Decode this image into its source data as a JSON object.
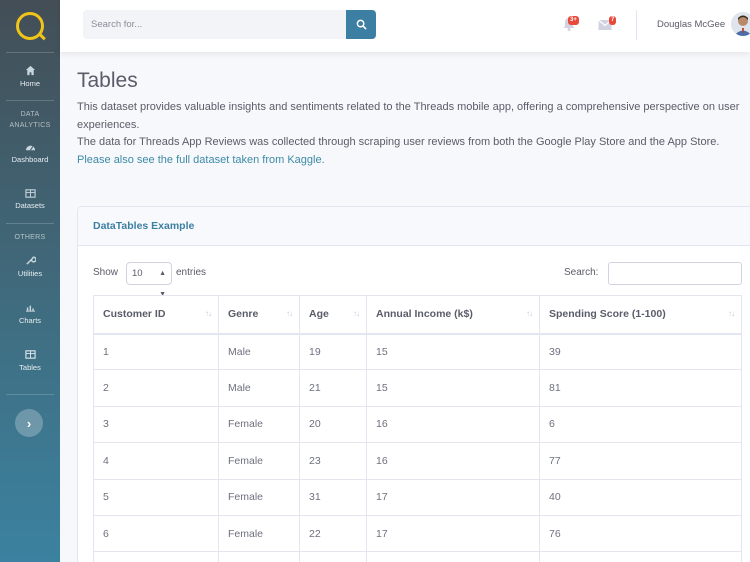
{
  "sidebar": {
    "items": [
      {
        "label": "Home",
        "icon": "home-icon"
      },
      {
        "label": "Dashboard",
        "icon": "dashboard-icon"
      },
      {
        "label": "Datasets",
        "icon": "table-icon"
      },
      {
        "label": "Utilities",
        "icon": "wrench-icon"
      },
      {
        "label": "Charts",
        "icon": "chart-icon"
      },
      {
        "label": "Tables",
        "icon": "table-icon"
      }
    ],
    "heading_data": "DATA ANALYTICS",
    "heading_others": "OTHERS",
    "toggle_label": "›"
  },
  "topbar": {
    "search_placeholder": "Search for...",
    "alerts_badge": "3+",
    "messages_badge": "7",
    "user_name": "Douglas McGee"
  },
  "page": {
    "title": "Tables",
    "desc1": "This dataset provides valuable insights and sentiments related to the Threads mobile app, offering a comprehensive perspective on user experiences.",
    "desc2": "The data for Threads App Reviews was collected through scraping user reviews from both the Google Play Store and the App Store.",
    "link": "Please also see the full dataset taken from Kaggle."
  },
  "card": {
    "title": "DataTables Example",
    "show_label": "Show",
    "entries_value": "10",
    "entries_label": "entries",
    "search_label": "Search:"
  },
  "table": {
    "columns": [
      "Customer ID",
      "Genre",
      "Age",
      "Annual Income (k$)",
      "Spending Score (1-100)"
    ],
    "rows": [
      [
        "1",
        "Male",
        "19",
        "15",
        "39"
      ],
      [
        "2",
        "Male",
        "21",
        "15",
        "81"
      ],
      [
        "3",
        "Female",
        "20",
        "16",
        "6"
      ],
      [
        "4",
        "Female",
        "23",
        "16",
        "77"
      ],
      [
        "5",
        "Female",
        "31",
        "17",
        "40"
      ],
      [
        "6",
        "Female",
        "22",
        "17",
        "76"
      ],
      [
        "",
        "",
        "",
        "",
        ""
      ]
    ]
  },
  "colors": {
    "accent": "#3d7fa3",
    "badge": "#e74a3b",
    "logo": "#f0c419"
  }
}
